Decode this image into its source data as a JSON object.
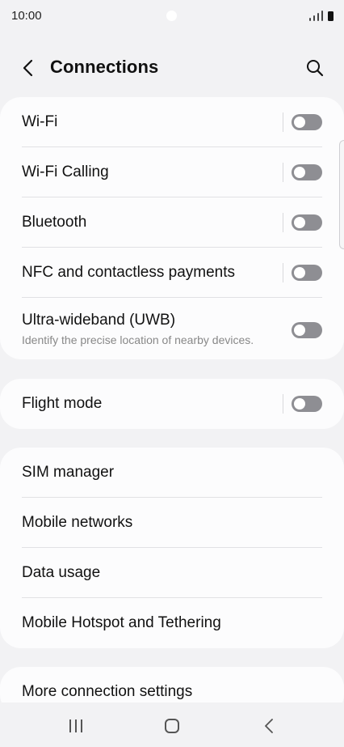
{
  "status_bar": {
    "time": "10:00"
  },
  "header": {
    "title": "Connections",
    "back_icon": "arrow-left-icon",
    "search_icon": "search-icon"
  },
  "groups": [
    {
      "items": [
        {
          "label": "Wi-Fi",
          "toggle": "off"
        },
        {
          "label": "Wi-Fi Calling",
          "toggle": "off"
        },
        {
          "label": "Bluetooth",
          "toggle": "off"
        },
        {
          "label": "NFC and contactless payments",
          "toggle": "off"
        },
        {
          "label": "Ultra-wideband (UWB)",
          "subtitle": "Identify the precise location of nearby devices.",
          "toggle": "off"
        }
      ]
    },
    {
      "items": [
        {
          "label": "Flight mode",
          "toggle": "off"
        }
      ]
    },
    {
      "items": [
        {
          "label": "SIM manager"
        },
        {
          "label": "Mobile networks"
        },
        {
          "label": "Data usage"
        },
        {
          "label": "Mobile Hotspot and Tethering"
        }
      ]
    },
    {
      "items": [
        {
          "label": "More connection settings"
        }
      ]
    }
  ],
  "nav_bar": {
    "recents_icon": "recents-icon",
    "home_icon": "home-icon",
    "back_icon": "back-icon"
  },
  "colors": {
    "background": "#f2f2f4",
    "card": "#fcfcfd",
    "toggle_off": "#8e8e93"
  }
}
